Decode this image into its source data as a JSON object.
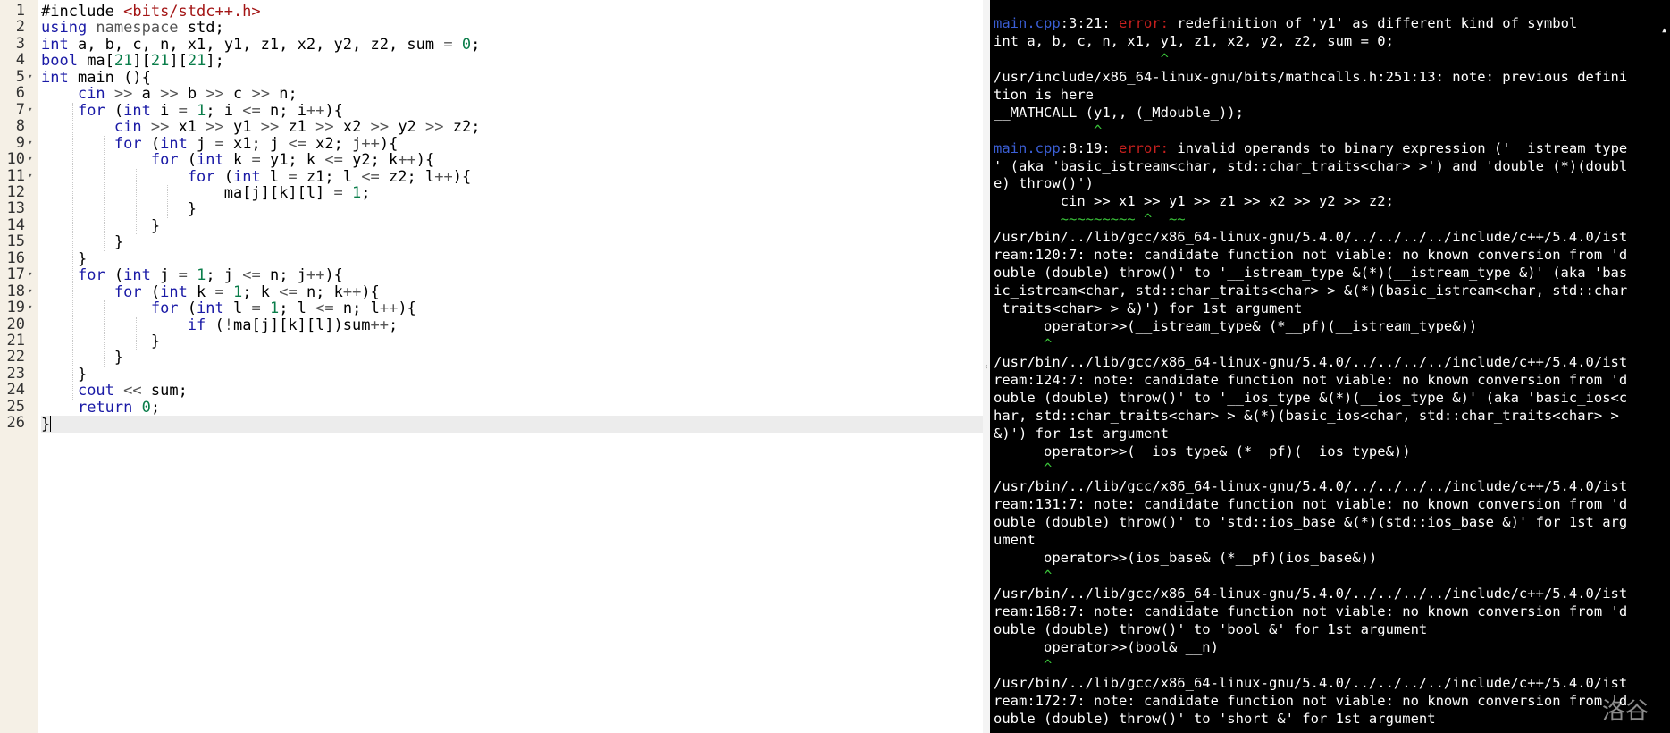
{
  "editor": {
    "lines": [
      {
        "n": "1",
        "fold": false,
        "tokens": [
          [
            "#include ",
            ""
          ],
          [
            "<bits/stdc++.h>",
            "str"
          ]
        ]
      },
      {
        "n": "2",
        "fold": false,
        "tokens": [
          [
            "using ",
            "kw"
          ],
          [
            "namespace ",
            "op"
          ],
          [
            "std;",
            ""
          ]
        ]
      },
      {
        "n": "3",
        "fold": false,
        "tokens": [
          [
            "int ",
            "kw"
          ],
          [
            "a, b, c, n, x1, y1, z1, x2, y2, z2, sum ",
            ""
          ],
          [
            "= ",
            "op"
          ],
          [
            "0",
            "num-lit"
          ],
          [
            ";",
            ""
          ]
        ]
      },
      {
        "n": "4",
        "fold": false,
        "tokens": [
          [
            "bool ",
            "kw"
          ],
          [
            "ma[",
            ""
          ],
          [
            "21",
            "num-lit"
          ],
          [
            "][",
            ""
          ],
          [
            "21",
            "num-lit"
          ],
          [
            "][",
            ""
          ],
          [
            "21",
            "num-lit"
          ],
          [
            "];",
            ""
          ]
        ]
      },
      {
        "n": "5",
        "fold": true,
        "tokens": [
          [
            "int ",
            "kw"
          ],
          [
            "main (){",
            ""
          ]
        ]
      },
      {
        "n": "6",
        "fold": false,
        "tokens": [
          [
            "    ",
            ""
          ],
          [
            "cin ",
            "kw"
          ],
          [
            ">> ",
            "op"
          ],
          [
            "a ",
            ""
          ],
          [
            ">> ",
            "op"
          ],
          [
            "b ",
            ""
          ],
          [
            ">> ",
            "op"
          ],
          [
            "c ",
            ""
          ],
          [
            ">> ",
            "op"
          ],
          [
            "n;",
            ""
          ]
        ]
      },
      {
        "n": "7",
        "fold": true,
        "tokens": [
          [
            "    ",
            ""
          ],
          [
            "for ",
            "kw"
          ],
          [
            "(",
            ""
          ],
          [
            "int ",
            "kw"
          ],
          [
            "i ",
            ""
          ],
          [
            "= ",
            "op"
          ],
          [
            "1",
            "num-lit"
          ],
          [
            "; i ",
            ""
          ],
          [
            "<= ",
            "op"
          ],
          [
            "n; i",
            ""
          ],
          [
            "++",
            "op"
          ],
          [
            "){",
            ""
          ]
        ]
      },
      {
        "n": "8",
        "fold": false,
        "tokens": [
          [
            "        ",
            ""
          ],
          [
            "cin ",
            "kw"
          ],
          [
            ">> ",
            "op"
          ],
          [
            "x1 ",
            ""
          ],
          [
            ">> ",
            "op"
          ],
          [
            "y1 ",
            ""
          ],
          [
            ">> ",
            "op"
          ],
          [
            "z1 ",
            ""
          ],
          [
            ">> ",
            "op"
          ],
          [
            "x2 ",
            ""
          ],
          [
            ">> ",
            "op"
          ],
          [
            "y2 ",
            ""
          ],
          [
            ">> ",
            "op"
          ],
          [
            "z2;",
            ""
          ]
        ]
      },
      {
        "n": "9",
        "fold": true,
        "tokens": [
          [
            "        ",
            ""
          ],
          [
            "for ",
            "kw"
          ],
          [
            "(",
            ""
          ],
          [
            "int ",
            "kw"
          ],
          [
            "j ",
            ""
          ],
          [
            "= ",
            "op"
          ],
          [
            "x1; j ",
            ""
          ],
          [
            "<= ",
            "op"
          ],
          [
            "x2; j",
            ""
          ],
          [
            "++",
            "op"
          ],
          [
            "){",
            ""
          ]
        ]
      },
      {
        "n": "10",
        "fold": true,
        "tokens": [
          [
            "            ",
            ""
          ],
          [
            "for ",
            "kw"
          ],
          [
            "(",
            ""
          ],
          [
            "int ",
            "kw"
          ],
          [
            "k ",
            ""
          ],
          [
            "= ",
            "op"
          ],
          [
            "y1; k ",
            ""
          ],
          [
            "<= ",
            "op"
          ],
          [
            "y2; k",
            ""
          ],
          [
            "++",
            "op"
          ],
          [
            "){",
            ""
          ]
        ]
      },
      {
        "n": "11",
        "fold": true,
        "tokens": [
          [
            "                ",
            ""
          ],
          [
            "for ",
            "kw"
          ],
          [
            "(",
            ""
          ],
          [
            "int ",
            "kw"
          ],
          [
            "l ",
            ""
          ],
          [
            "= ",
            "op"
          ],
          [
            "z1; l ",
            ""
          ],
          [
            "<= ",
            "op"
          ],
          [
            "z2; l",
            ""
          ],
          [
            "++",
            "op"
          ],
          [
            "){",
            ""
          ]
        ]
      },
      {
        "n": "12",
        "fold": false,
        "tokens": [
          [
            "                    ",
            ""
          ],
          [
            "ma[j][k][l] ",
            ""
          ],
          [
            "= ",
            "op"
          ],
          [
            "1",
            "num-lit"
          ],
          [
            ";",
            ""
          ]
        ]
      },
      {
        "n": "13",
        "fold": false,
        "tokens": [
          [
            "                ",
            ""
          ],
          [
            "}",
            ""
          ]
        ]
      },
      {
        "n": "14",
        "fold": false,
        "tokens": [
          [
            "            ",
            ""
          ],
          [
            "}",
            ""
          ]
        ]
      },
      {
        "n": "15",
        "fold": false,
        "tokens": [
          [
            "        ",
            ""
          ],
          [
            "}",
            ""
          ]
        ]
      },
      {
        "n": "16",
        "fold": false,
        "tokens": [
          [
            "    ",
            ""
          ],
          [
            "}",
            ""
          ]
        ]
      },
      {
        "n": "17",
        "fold": true,
        "tokens": [
          [
            "    ",
            ""
          ],
          [
            "for ",
            "kw"
          ],
          [
            "(",
            ""
          ],
          [
            "int ",
            "kw"
          ],
          [
            "j ",
            ""
          ],
          [
            "= ",
            "op"
          ],
          [
            "1",
            "num-lit"
          ],
          [
            "; j ",
            ""
          ],
          [
            "<= ",
            "op"
          ],
          [
            "n; j",
            ""
          ],
          [
            "++",
            "op"
          ],
          [
            "){",
            ""
          ]
        ]
      },
      {
        "n": "18",
        "fold": true,
        "tokens": [
          [
            "        ",
            ""
          ],
          [
            "for ",
            "kw"
          ],
          [
            "(",
            ""
          ],
          [
            "int ",
            "kw"
          ],
          [
            "k ",
            ""
          ],
          [
            "= ",
            "op"
          ],
          [
            "1",
            "num-lit"
          ],
          [
            "; k ",
            ""
          ],
          [
            "<= ",
            "op"
          ],
          [
            "n; k",
            ""
          ],
          [
            "++",
            "op"
          ],
          [
            "){",
            ""
          ]
        ]
      },
      {
        "n": "19",
        "fold": true,
        "tokens": [
          [
            "            ",
            ""
          ],
          [
            "for ",
            "kw"
          ],
          [
            "(",
            ""
          ],
          [
            "int ",
            "kw"
          ],
          [
            "l ",
            ""
          ],
          [
            "= ",
            "op"
          ],
          [
            "1",
            "num-lit"
          ],
          [
            "; l ",
            ""
          ],
          [
            "<= ",
            "op"
          ],
          [
            "n; l",
            ""
          ],
          [
            "++",
            "op"
          ],
          [
            "){",
            ""
          ]
        ]
      },
      {
        "n": "20",
        "fold": false,
        "tokens": [
          [
            "                ",
            ""
          ],
          [
            "if ",
            "kw"
          ],
          [
            "(",
            ""
          ],
          [
            "!",
            "op"
          ],
          [
            "ma[j][k][l])sum",
            ""
          ],
          [
            "++",
            "op"
          ],
          [
            ";",
            ""
          ]
        ]
      },
      {
        "n": "21",
        "fold": false,
        "tokens": [
          [
            "            ",
            ""
          ],
          [
            "}",
            ""
          ]
        ]
      },
      {
        "n": "22",
        "fold": false,
        "tokens": [
          [
            "        ",
            ""
          ],
          [
            "}",
            ""
          ]
        ]
      },
      {
        "n": "23",
        "fold": false,
        "tokens": [
          [
            "    ",
            ""
          ],
          [
            "}",
            ""
          ]
        ]
      },
      {
        "n": "24",
        "fold": false,
        "tokens": [
          [
            "    ",
            ""
          ],
          [
            "cout ",
            "kw"
          ],
          [
            "<< ",
            "op"
          ],
          [
            "sum;",
            ""
          ]
        ]
      },
      {
        "n": "25",
        "fold": false,
        "tokens": [
          [
            "    ",
            ""
          ],
          [
            "return ",
            "kw"
          ],
          [
            "0",
            "num-lit"
          ],
          [
            ";",
            ""
          ]
        ]
      },
      {
        "n": "26",
        "fold": false,
        "tokens": [
          [
            "}",
            ""
          ]
        ],
        "active": true
      }
    ]
  },
  "console": {
    "lines": [
      [
        [
          "main.cpp",
          "file"
        ],
        [
          ":3:21: ",
          ""
        ],
        [
          "error:",
          "err"
        ],
        [
          " redefinition of 'y1' as different kind of symbol",
          ""
        ]
      ],
      [
        [
          "int a, b, c, n, x1, y1, z1, x2, y2, z2, sum = 0;",
          ""
        ]
      ],
      [
        [
          "                    ^",
          "caretmark"
        ]
      ],
      [
        [
          "/usr/include/x86_64-linux-gnu/bits/mathcalls.h:251:13: note: previous defini",
          ""
        ]
      ],
      [
        [
          "tion is here",
          ""
        ]
      ],
      [
        [
          "__MATHCALL (y1,, (_Mdouble_));",
          ""
        ]
      ],
      [
        [
          "            ^",
          "caretmark"
        ]
      ],
      [
        [
          "main.cpp",
          "file"
        ],
        [
          ":8:19: ",
          ""
        ],
        [
          "error:",
          "err"
        ],
        [
          " invalid operands to binary expression ('__istream_type",
          ""
        ]
      ],
      [
        [
          "' (aka 'basic_istream<char, std::char_traits<char> >') and 'double (*)(doubl",
          ""
        ]
      ],
      [
        [
          "e) throw()')",
          ""
        ]
      ],
      [
        [
          "        cin >> x1 >> y1 >> z1 >> x2 >> y2 >> z2;",
          ""
        ]
      ],
      [
        [
          "        ~~~~~~~~~ ^  ~~",
          "caretmark"
        ]
      ],
      [
        [
          "/usr/bin/../lib/gcc/x86_64-linux-gnu/5.4.0/../../../../include/c++/5.4.0/ist",
          ""
        ]
      ],
      [
        [
          "ream:120:7: note: candidate function not viable: no known conversion from 'd",
          ""
        ]
      ],
      [
        [
          "ouble (double) throw()' to '__istream_type &(*)(__istream_type &)' (aka 'bas",
          ""
        ]
      ],
      [
        [
          "ic_istream<char, std::char_traits<char> > &(*)(basic_istream<char, std::char",
          ""
        ]
      ],
      [
        [
          "_traits<char> > &)') for 1st argument",
          ""
        ]
      ],
      [
        [
          "      operator>>(__istream_type& (*__pf)(__istream_type&))",
          ""
        ]
      ],
      [
        [
          "      ^",
          "caretmark"
        ]
      ],
      [
        [
          "/usr/bin/../lib/gcc/x86_64-linux-gnu/5.4.0/../../../../include/c++/5.4.0/ist",
          ""
        ]
      ],
      [
        [
          "ream:124:7: note: candidate function not viable: no known conversion from 'd",
          ""
        ]
      ],
      [
        [
          "ouble (double) throw()' to '__ios_type &(*)(__ios_type &)' (aka 'basic_ios<c",
          ""
        ]
      ],
      [
        [
          "har, std::char_traits<char> > &(*)(basic_ios<char, std::char_traits<char> >",
          ""
        ]
      ],
      [
        [
          "&)') for 1st argument",
          ""
        ]
      ],
      [
        [
          "      operator>>(__ios_type& (*__pf)(__ios_type&))",
          ""
        ]
      ],
      [
        [
          "      ^",
          "caretmark"
        ]
      ],
      [
        [
          "/usr/bin/../lib/gcc/x86_64-linux-gnu/5.4.0/../../../../include/c++/5.4.0/ist",
          ""
        ]
      ],
      [
        [
          "ream:131:7: note: candidate function not viable: no known conversion from 'd",
          ""
        ]
      ],
      [
        [
          "ouble (double) throw()' to 'std::ios_base &(*)(std::ios_base &)' for 1st arg",
          ""
        ]
      ],
      [
        [
          "ument",
          ""
        ]
      ],
      [
        [
          "      operator>>(ios_base& (*__pf)(ios_base&))",
          ""
        ]
      ],
      [
        [
          "      ^",
          "caretmark"
        ]
      ],
      [
        [
          "/usr/bin/../lib/gcc/x86_64-linux-gnu/5.4.0/../../../../include/c++/5.4.0/ist",
          ""
        ]
      ],
      [
        [
          "ream:168:7: note: candidate function not viable: no known conversion from 'd",
          ""
        ]
      ],
      [
        [
          "ouble (double) throw()' to 'bool &' for 1st argument",
          ""
        ]
      ],
      [
        [
          "      operator>>(bool& __n)",
          ""
        ]
      ],
      [
        [
          "      ^",
          "caretmark"
        ]
      ],
      [
        [
          "/usr/bin/../lib/gcc/x86_64-linux-gnu/5.4.0/../../../../include/c++/5.4.0/ist",
          ""
        ]
      ],
      [
        [
          "ream:172:7: note: candidate function not viable: no known conversion from 'd",
          ""
        ]
      ],
      [
        [
          "ouble (double) throw()' to 'short &' for 1st argument",
          ""
        ]
      ]
    ],
    "watermark": "洛谷"
  },
  "colors": {
    "keyword": "#1a1aa6",
    "string": "#a31515",
    "number": "#0a7d4a",
    "console_file": "#3b5fd6",
    "console_error": "#c8201e",
    "console_caret": "#3ac43a",
    "console_bg": "#000000",
    "gutter_bg": "#f5f0e6"
  }
}
